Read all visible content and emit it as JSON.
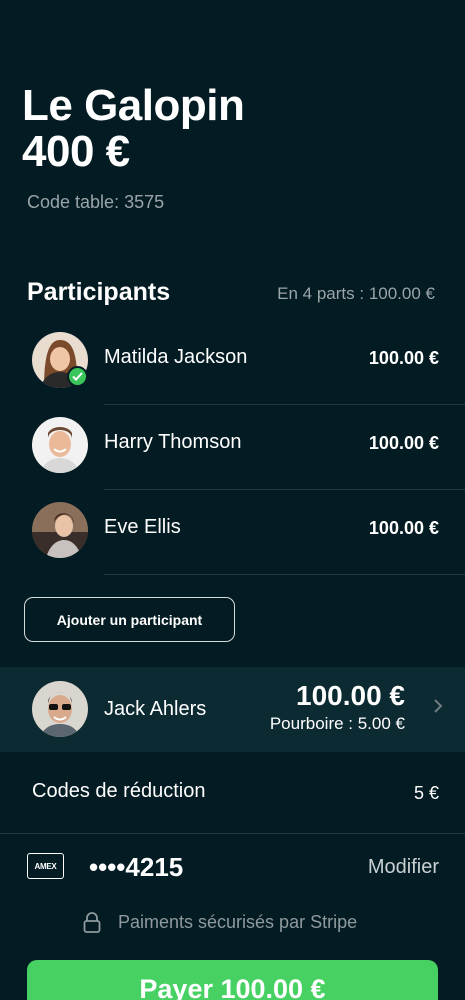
{
  "restaurant": {
    "name": "Le Galopin",
    "total": "400 €",
    "table_code": "Code table: 3575"
  },
  "participants": {
    "title": "Participants",
    "split_info": "En 4 parts : 100.00 €",
    "items": [
      {
        "name": "Matilda Jackson",
        "amount": "100.00 €",
        "paid": true
      },
      {
        "name": "Harry Thomson",
        "amount": "100.00 €",
        "paid": false
      },
      {
        "name": "Eve Ellis",
        "amount": "100.00 €",
        "paid": false
      }
    ],
    "add_label": "Ajouter un participant"
  },
  "payer": {
    "name": "Jack Ahlers",
    "amount": "100.00 €",
    "tip": "Pourboire : 5.00 €"
  },
  "discount": {
    "label": "Codes de réduction",
    "value": "5 €"
  },
  "card": {
    "brand": "AMEX",
    "number": "••••4215",
    "modify_label": "Modifier"
  },
  "security": {
    "text": "Paiments sécurisés par Stripe"
  },
  "pay_button": {
    "label": "Payer 100.00 €"
  },
  "colors": {
    "background": "#031b22",
    "accent": "#47d163",
    "highlight_row": "#0b2a31"
  }
}
